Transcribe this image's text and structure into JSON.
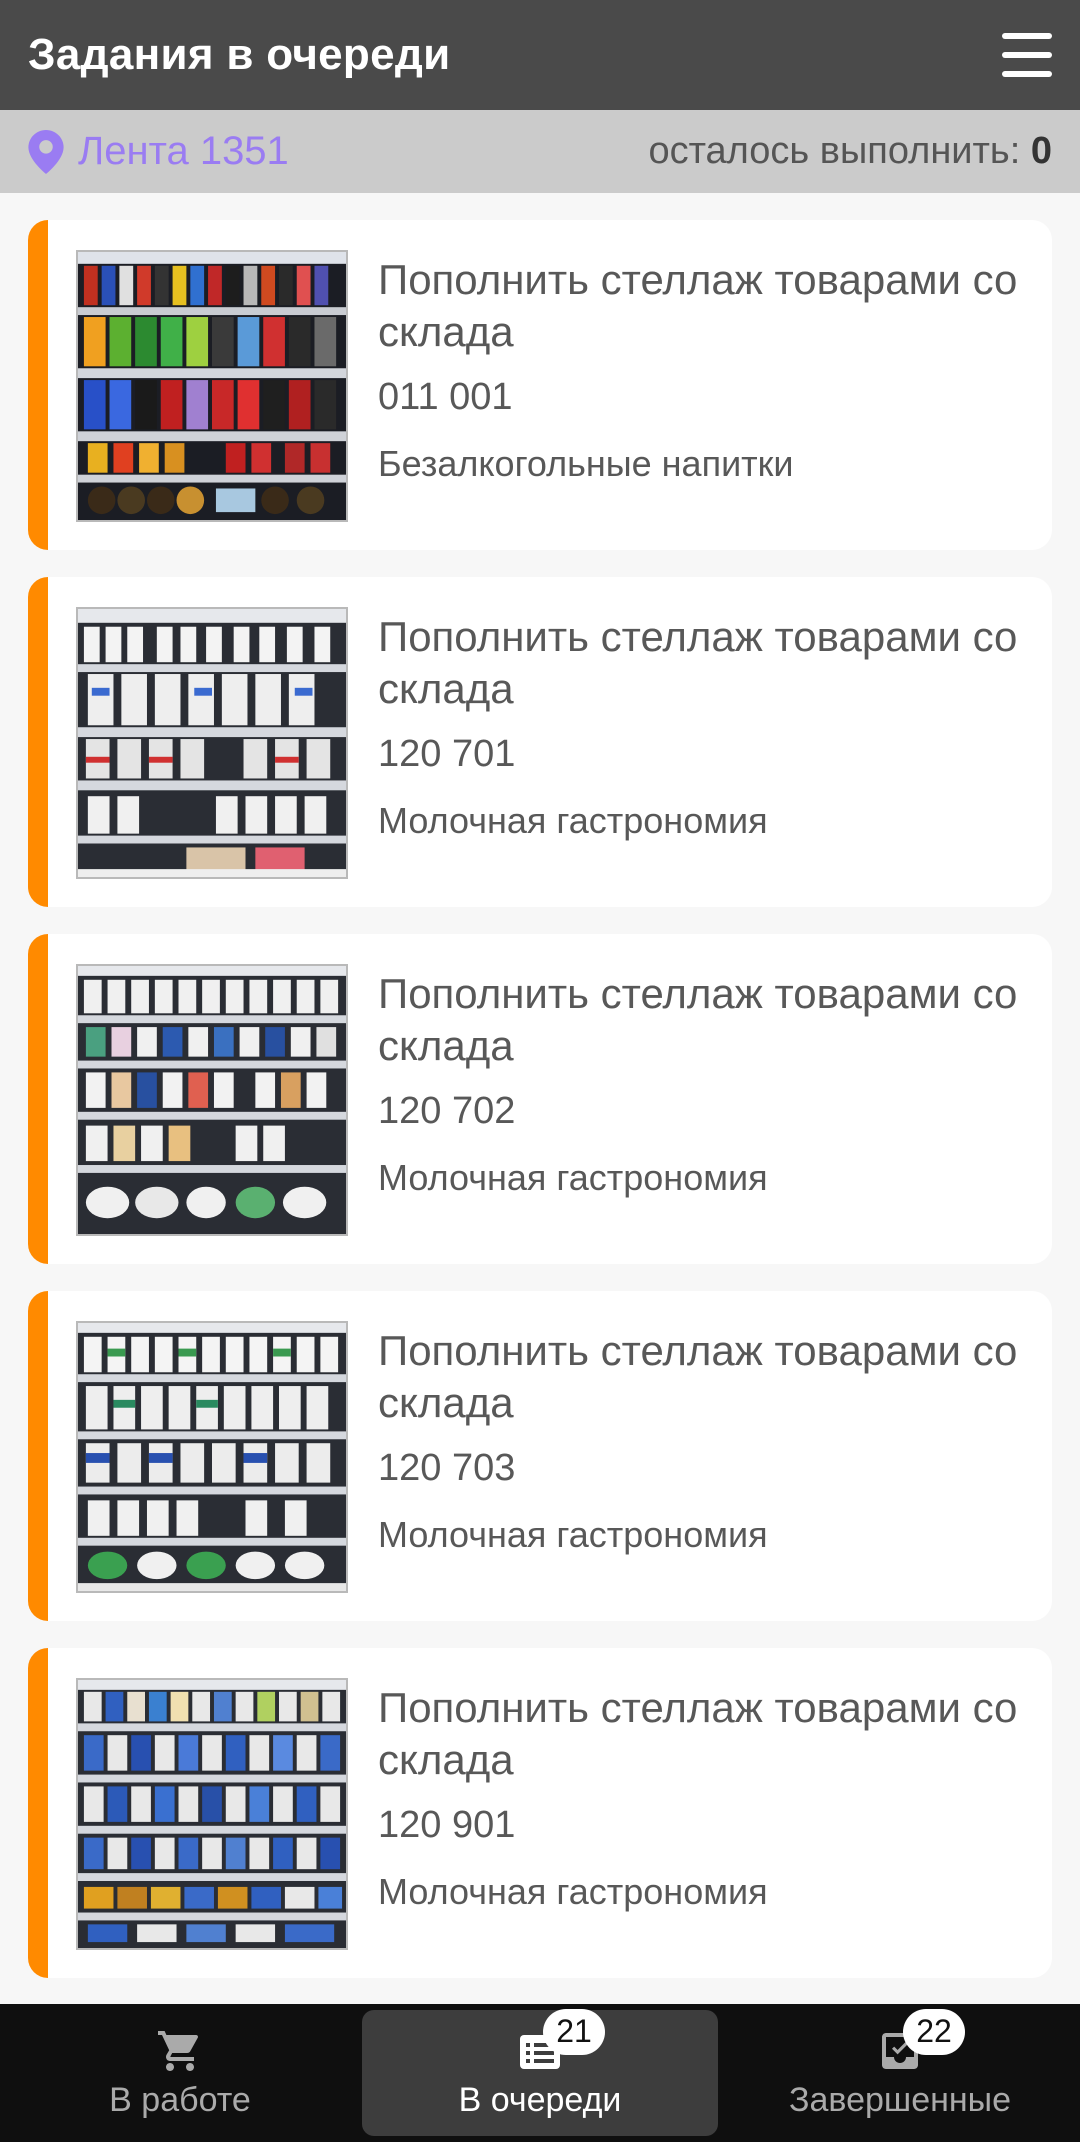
{
  "header": {
    "title": "Задания в очереди",
    "menu_icon": "hamburger-icon"
  },
  "subbar": {
    "store_name": "Лента 1351",
    "remaining_label": "осталось выполнить:",
    "remaining_count": "0"
  },
  "colors": {
    "accent": "#ff8a00",
    "store": "#9a7cf2",
    "header_bg": "#4a4a4a"
  },
  "tasks": [
    {
      "title": "Пополнить стеллаж товарами со склада",
      "code": "011 001",
      "category": "Безалкогольные напитки"
    },
    {
      "title": "Пополнить стеллаж товарами со склада",
      "code": "120 701",
      "category": "Молочная гастрономия"
    },
    {
      "title": "Пополнить стеллаж товарами со склада",
      "code": "120 702",
      "category": "Молочная гастрономия"
    },
    {
      "title": "Пополнить стеллаж товарами со склада",
      "code": "120 703",
      "category": "Молочная гастрономия"
    },
    {
      "title": "Пополнить стеллаж товарами со склада",
      "code": "120 901",
      "category": "Молочная гастрономия"
    }
  ],
  "nav": {
    "in_work": {
      "label": "В работе",
      "icon": "cart-icon"
    },
    "queued": {
      "label": "В очереди",
      "icon": "list-icon",
      "badge": "21"
    },
    "done": {
      "label": "Завершенные",
      "icon": "inbox-check-icon",
      "badge": "22"
    }
  }
}
